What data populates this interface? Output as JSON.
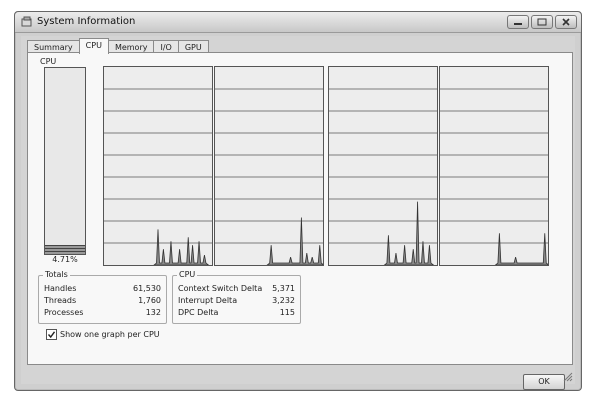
{
  "window": {
    "title": "System Information"
  },
  "tabs": [
    {
      "label": "Summary",
      "active": false
    },
    {
      "label": "CPU",
      "active": true
    },
    {
      "label": "Memory",
      "active": false
    },
    {
      "label": "I/O",
      "active": false
    },
    {
      "label": "GPU",
      "active": false
    }
  ],
  "cpu": {
    "label": "CPU",
    "percent_text": "4.71%",
    "usage_fraction": 0.0471
  },
  "graphs": [
    {
      "name": "cpu-0",
      "peaks": [
        [
          0.5,
          0.18
        ],
        [
          0.55,
          0.08
        ],
        [
          0.62,
          0.12
        ],
        [
          0.7,
          0.08
        ],
        [
          0.78,
          0.14
        ],
        [
          0.82,
          0.1
        ],
        [
          0.88,
          0.12
        ],
        [
          0.93,
          0.05
        ]
      ]
    },
    {
      "name": "cpu-1",
      "peaks": [
        [
          0.52,
          0.1
        ],
        [
          0.7,
          0.04
        ],
        [
          0.8,
          0.24
        ],
        [
          0.85,
          0.06
        ],
        [
          0.9,
          0.04
        ],
        [
          0.97,
          0.1
        ]
      ]
    },
    {
      "name": "cpu-2",
      "peaks": [
        [
          0.55,
          0.15
        ],
        [
          0.62,
          0.06
        ],
        [
          0.7,
          0.1
        ],
        [
          0.78,
          0.08
        ],
        [
          0.82,
          0.32
        ],
        [
          0.87,
          0.12
        ],
        [
          0.93,
          0.1
        ]
      ]
    },
    {
      "name": "cpu-3",
      "peaks": [
        [
          0.55,
          0.16
        ],
        [
          0.7,
          0.04
        ],
        [
          0.97,
          0.16
        ]
      ]
    }
  ],
  "totals": {
    "title": "Totals",
    "rows": [
      {
        "label": "Handles",
        "value": "61,530"
      },
      {
        "label": "Threads",
        "value": "1,760"
      },
      {
        "label": "Processes",
        "value": "132"
      }
    ]
  },
  "cpu_stats": {
    "title": "CPU",
    "rows": [
      {
        "label": "Context Switch Delta",
        "value": "5,371"
      },
      {
        "label": "Interrupt Delta",
        "value": "3,232"
      },
      {
        "label": "DPC Delta",
        "value": "115"
      }
    ]
  },
  "checkbox": {
    "label": "Show one graph per CPU",
    "checked": true
  },
  "ok_button": {
    "label": "OK"
  }
}
